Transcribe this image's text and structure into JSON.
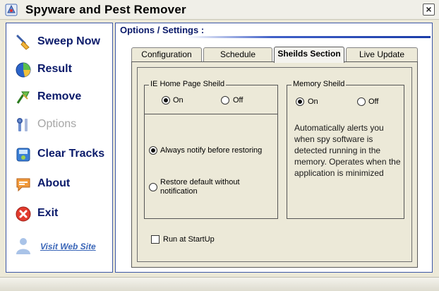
{
  "window": {
    "title": "Spyware and Pest Remover",
    "close_label": "×"
  },
  "sidebar": {
    "items": [
      {
        "label": "Sweep Now",
        "icon": "broom-icon",
        "enabled": true
      },
      {
        "label": "Result",
        "icon": "chart-icon",
        "enabled": true
      },
      {
        "label": "Remove",
        "icon": "bug-spray-icon",
        "enabled": true
      },
      {
        "label": "Options",
        "icon": "tools-icon",
        "enabled": false
      },
      {
        "label": "Clear Tracks",
        "icon": "disk-icon",
        "enabled": true
      },
      {
        "label": "About",
        "icon": "speech-bubble-icon",
        "enabled": true
      },
      {
        "label": "Exit",
        "icon": "exit-icon",
        "enabled": true
      }
    ],
    "visit_link": "Visit Web Site"
  },
  "main": {
    "title": "Options / Settings :",
    "tabs": [
      {
        "label": "Configuration",
        "active": false
      },
      {
        "label": "Schedule",
        "active": false
      },
      {
        "label": "Sheilds Section",
        "active": true
      },
      {
        "label": "Live Update",
        "active": false
      }
    ],
    "ie_shield": {
      "legend": "IE Home Page Sheild",
      "on_label": "On",
      "off_label": "Off",
      "selected": "On",
      "option1": "Always notify before restoring",
      "option2": "Restore default without notification",
      "selected_option": "Always notify before restoring"
    },
    "memory_shield": {
      "legend": "Memory Sheild",
      "on_label": "On",
      "off_label": "Off",
      "selected": "On",
      "description": "Automatically alerts you when spy software is detected running in the memory. Operates when the application is minimized"
    },
    "run_at_startup": {
      "label": "Run at StartUp",
      "checked": false
    }
  },
  "colors": {
    "accent": "#0a1a6a",
    "border": "#3b56a6",
    "link": "#3a66b8",
    "window_bg": "#ece9d8"
  }
}
